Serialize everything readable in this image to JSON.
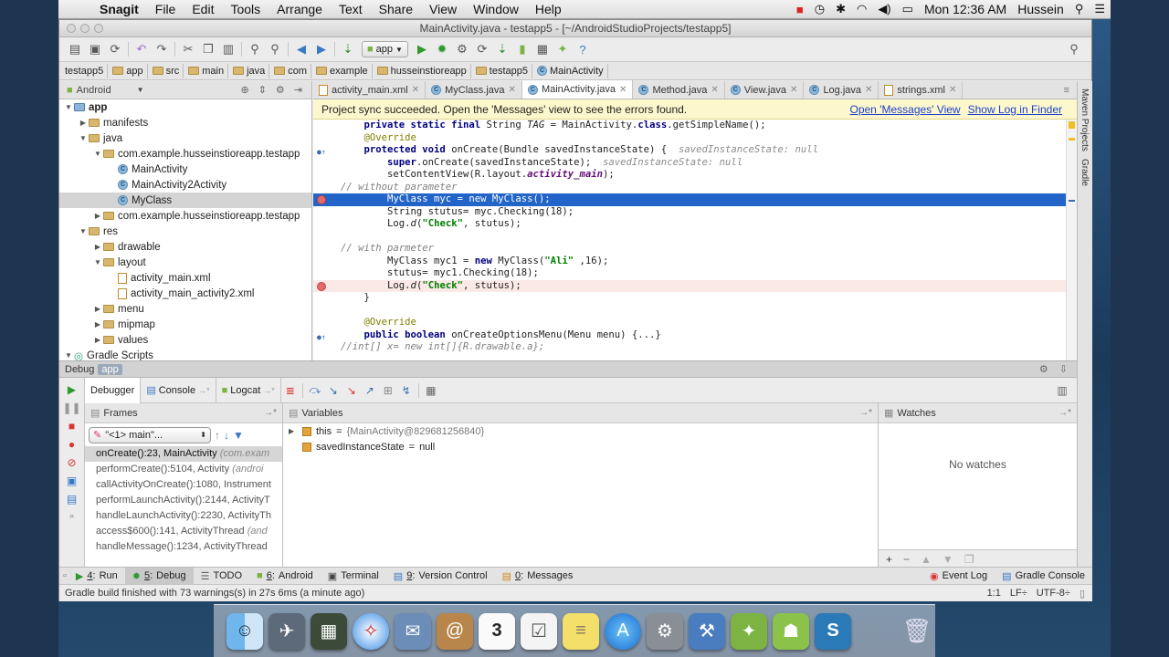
{
  "menubar": {
    "app": "Snagit",
    "items": [
      "File",
      "Edit",
      "Tools",
      "Arrange",
      "Text",
      "Share",
      "View",
      "Window",
      "Help"
    ],
    "clock": "Mon 12:36 AM",
    "user": "Hussein"
  },
  "window": {
    "title": "MainActivity.java - testapp5 - [~/AndroidStudioProjects/testapp5]"
  },
  "toolbar": {
    "run_config": "app"
  },
  "breadcrumb": [
    "testapp5",
    "app",
    "src",
    "main",
    "java",
    "com",
    "example",
    "husseinstioreapp",
    "testapp5",
    "MainActivity"
  ],
  "project": {
    "view": "Android",
    "tree": [
      {
        "label": "app",
        "level": 0,
        "arrow": "▼",
        "icon": "module",
        "bold": true
      },
      {
        "label": "manifests",
        "level": 1,
        "arrow": "▶",
        "icon": "folder"
      },
      {
        "label": "java",
        "level": 1,
        "arrow": "▼",
        "icon": "folder"
      },
      {
        "label": "com.example.husseinstioreapp.testapp",
        "level": 2,
        "arrow": "▼",
        "icon": "folder"
      },
      {
        "label": "MainActivity",
        "level": 3,
        "arrow": "",
        "icon": "class"
      },
      {
        "label": "MainActivity2Activity",
        "level": 3,
        "arrow": "",
        "icon": "class"
      },
      {
        "label": "MyClass",
        "level": 3,
        "arrow": "",
        "icon": "class",
        "selected": true
      },
      {
        "label": "com.example.husseinstioreapp.testapp",
        "level": 2,
        "arrow": "▶",
        "icon": "folder"
      },
      {
        "label": "res",
        "level": 1,
        "arrow": "▼",
        "icon": "folder"
      },
      {
        "label": "drawable",
        "level": 2,
        "arrow": "▶",
        "icon": "folder"
      },
      {
        "label": "layout",
        "level": 2,
        "arrow": "▼",
        "icon": "folder"
      },
      {
        "label": "activity_main.xml",
        "level": 3,
        "arrow": "",
        "icon": "xml"
      },
      {
        "label": "activity_main_activity2.xml",
        "level": 3,
        "arrow": "",
        "icon": "xml"
      },
      {
        "label": "menu",
        "level": 2,
        "arrow": "▶",
        "icon": "folder"
      },
      {
        "label": "mipmap",
        "level": 2,
        "arrow": "▶",
        "icon": "folder"
      },
      {
        "label": "values",
        "level": 2,
        "arrow": "▶",
        "icon": "folder"
      },
      {
        "label": "Gradle Scripts",
        "level": 0,
        "arrow": "▼",
        "icon": "gradle"
      }
    ]
  },
  "editor": {
    "tabs": [
      {
        "label": "activity_main.xml",
        "icon": "xml"
      },
      {
        "label": "MyClass.java",
        "icon": "class"
      },
      {
        "label": "MainActivity.java",
        "icon": "class",
        "active": true
      },
      {
        "label": "Method.java",
        "icon": "class"
      },
      {
        "label": "View.java",
        "icon": "class"
      },
      {
        "label": "Log.java",
        "icon": "class"
      },
      {
        "label": "strings.xml",
        "icon": "xml"
      }
    ],
    "notification": {
      "message": "Project sync succeeded. Open the 'Messages' view to see the errors found.",
      "link1": "Open 'Messages' View",
      "link2": "Show Log in Finder"
    },
    "lines": [
      {
        "indent": "    ",
        "segs": [
          [
            "kw",
            "private static final "
          ],
          [
            "",
            "String "
          ],
          [
            "it",
            "TAG"
          ],
          [
            "",
            " = MainActivity."
          ],
          [
            "kw",
            "class"
          ],
          [
            "",
            ".getSimpleName();"
          ]
        ]
      },
      {
        "indent": "    ",
        "segs": [
          [
            "an",
            "@Override"
          ]
        ]
      },
      {
        "indent": "    ",
        "marker": "override",
        "segs": [
          [
            "kw",
            "protected void "
          ],
          [
            "",
            "onCreate(Bundle savedInstanceState) {  "
          ],
          [
            "hint",
            "savedInstanceState: null"
          ]
        ]
      },
      {
        "indent": "        ",
        "segs": [
          [
            "kw",
            "super"
          ],
          [
            "",
            ".onCreate(savedInstanceState);  "
          ],
          [
            "hint",
            "savedInstanceState: null"
          ]
        ]
      },
      {
        "indent": "        ",
        "segs": [
          [
            "",
            "setContentView(R.layout."
          ],
          [
            "itb",
            "activity_main"
          ],
          [
            "",
            ");"
          ]
        ]
      },
      {
        "indent": "",
        "segs": [
          [
            "cm",
            "// without parameter"
          ]
        ]
      },
      {
        "indent": "        ",
        "breakpoint": true,
        "highlight": "current",
        "segs": [
          [
            "",
            "MyClass myc = new MyClass();"
          ]
        ]
      },
      {
        "indent": "        ",
        "segs": [
          [
            "",
            "String stutus= myc.Checking("
          ],
          [
            "",
            "18"
          ],
          [
            "",
            ");"
          ]
        ]
      },
      {
        "indent": "        ",
        "segs": [
          [
            "",
            "Log."
          ],
          [
            "it",
            "d"
          ],
          [
            "",
            "("
          ],
          [
            "st",
            "\"Check\""
          ],
          [
            "",
            ", stutus);"
          ]
        ]
      },
      {
        "indent": "",
        "segs": [
          [
            "",
            ""
          ]
        ]
      },
      {
        "indent": "",
        "segs": [
          [
            "cm",
            "// with parmeter"
          ]
        ]
      },
      {
        "indent": "        ",
        "segs": [
          [
            "",
            "MyClass myc1 = "
          ],
          [
            "kw",
            "new "
          ],
          [
            "",
            "MyClass("
          ],
          [
            "st",
            "\"Ali\""
          ],
          [
            "",
            " ,16);"
          ]
        ]
      },
      {
        "indent": "        ",
        "segs": [
          [
            "",
            "stutus= myc1.Checking(18);"
          ]
        ]
      },
      {
        "indent": "        ",
        "breakpoint": true,
        "highlight": "bp",
        "segs": [
          [
            "",
            "Log."
          ],
          [
            "it",
            "d"
          ],
          [
            "",
            "("
          ],
          [
            "st",
            "\"Check\""
          ],
          [
            "",
            ", stutus);"
          ]
        ]
      },
      {
        "indent": "    ",
        "segs": [
          [
            "",
            "}"
          ]
        ]
      },
      {
        "indent": "",
        "segs": [
          [
            "",
            ""
          ]
        ]
      },
      {
        "indent": "    ",
        "segs": [
          [
            "an",
            "@Override"
          ]
        ]
      },
      {
        "indent": "    ",
        "marker": "override",
        "segs": [
          [
            "kw",
            "public boolean "
          ],
          [
            "",
            "onCreateOptionsMenu(Menu menu) "
          ],
          [
            "",
            "{...}"
          ]
        ]
      },
      {
        "indent": "",
        "segs": [
          [
            "cm",
            "//int[] x= new int[]{R.drawable.a};"
          ]
        ]
      }
    ]
  },
  "right_strip": [
    "Maven Projects",
    "Gradle"
  ],
  "debug": {
    "title": "Debug",
    "config": "app",
    "tabs": [
      "Debugger",
      "Console",
      "Logcat"
    ],
    "frames_label": "Frames",
    "variables_label": "Variables",
    "watches_label": "Watches",
    "thread": "\"<1> main\"...",
    "frames": [
      {
        "text": "onCreate():23, MainActivity ",
        "extra": "(com.exam",
        "selected": true
      },
      {
        "text": "performCreate():5104, Activity ",
        "extra": "(androi"
      },
      {
        "text": "callActivityOnCreate():1080, Instrument",
        "extra": ""
      },
      {
        "text": "performLaunchActivity():2144, ActivityT",
        "extra": ""
      },
      {
        "text": "handleLaunchActivity():2230, ActivityTh",
        "extra": ""
      },
      {
        "text": "access$600():141, ActivityThread ",
        "extra": "(and"
      },
      {
        "text": "handleMessage():1234, ActivityThread",
        "extra": ""
      }
    ],
    "variables": [
      {
        "name": "this",
        "value": "{MainActivity@829681256840}",
        "expandable": true
      },
      {
        "name": "savedInstanceState",
        "value": "null",
        "expandable": false
      }
    ],
    "no_watches": "No watches"
  },
  "tool_tabs": [
    {
      "num": "4",
      "label": "Run"
    },
    {
      "num": "5",
      "label": "Debug",
      "active": true
    },
    {
      "num": "",
      "label": "TODO"
    },
    {
      "num": "6",
      "label": "Android"
    },
    {
      "num": "",
      "label": "Terminal"
    },
    {
      "num": "9",
      "label": "Version Control"
    },
    {
      "num": "0",
      "label": "Messages"
    }
  ],
  "tool_tabs_right": [
    {
      "num": "",
      "label": "Event Log"
    },
    {
      "num": "",
      "label": "Gradle Console"
    }
  ],
  "status": {
    "message": "Gradle build finished with 73 warnings(s) in 27s 6ms (a minute ago)",
    "position": "1:1",
    "line_sep": "LF÷",
    "encoding": "UTF-8÷"
  },
  "colors": {
    "selection": "#2264c8",
    "breakpoint": "#e36b6b",
    "notify_bg": "#fdf7cd"
  }
}
